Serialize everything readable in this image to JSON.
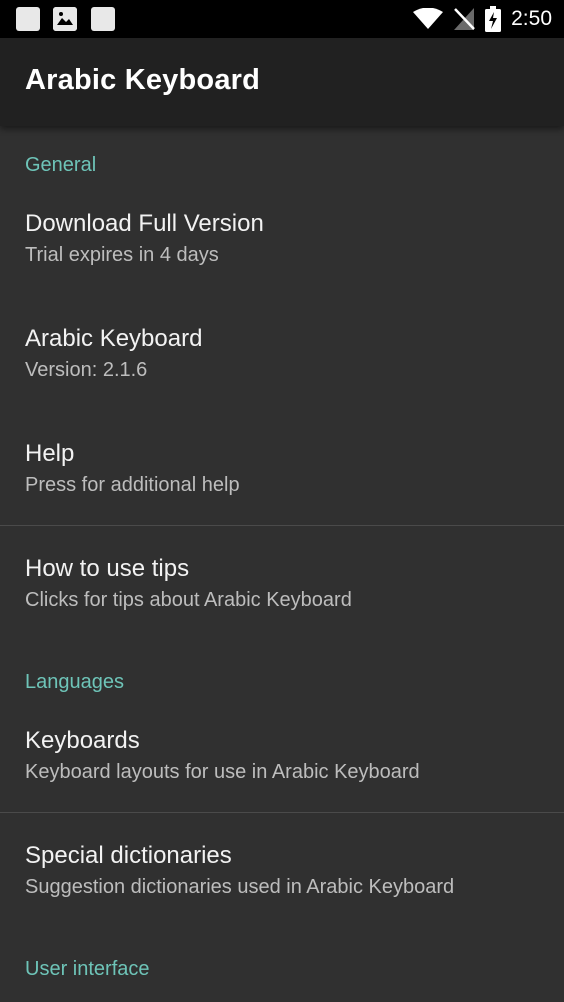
{
  "status_bar": {
    "time": "2:50",
    "notification_icons": [
      "notification-square-icon",
      "image-icon",
      "notification-square-icon"
    ],
    "system_icons": [
      "wifi-icon",
      "no-signal-icon",
      "battery-charging-icon"
    ]
  },
  "app_bar": {
    "title": "Arabic Keyboard"
  },
  "sections": {
    "general": {
      "label": "General",
      "items": [
        {
          "title": "Download Full Version",
          "summary": "Trial expires in 4 days"
        },
        {
          "title": "Arabic Keyboard",
          "summary": "Version: 2.1.6"
        },
        {
          "title": "Help",
          "summary": "Press for additional help"
        },
        {
          "title": "How to use tips",
          "summary": "Clicks for tips about Arabic Keyboard"
        }
      ]
    },
    "languages": {
      "label": "Languages",
      "items": [
        {
          "title": "Keyboards",
          "summary": "Keyboard layouts for use in Arabic Keyboard"
        },
        {
          "title": "Special dictionaries",
          "summary": "Suggestion dictionaries used in Arabic Keyboard"
        }
      ]
    },
    "user_interface": {
      "label": "User interface"
    }
  },
  "colors": {
    "background": "#303030",
    "app_bar": "#212121",
    "accent": "#6ec4b8",
    "title_text": "#f2f2f2",
    "summary_text": "#bdbdbd"
  }
}
